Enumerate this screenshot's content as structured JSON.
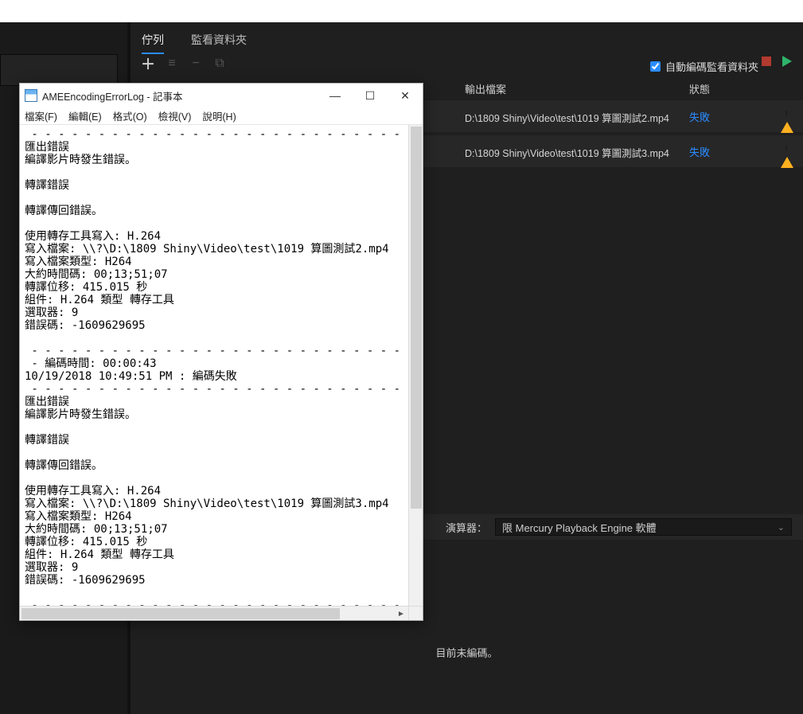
{
  "app": {
    "tabs": {
      "queue": "佇列",
      "watch": "監看資料夾"
    },
    "auto_watch": "自動編碼監看資料夾",
    "columns": {
      "output": "輸出檔案",
      "status": "狀態"
    },
    "rows": [
      {
        "output": "D:\\1809 Shiny\\Video\\test\\1019 算圖測試2.mp4",
        "status": "失敗"
      },
      {
        "output": "D:\\1809 Shiny\\Video\\test\\1019 算圖測試3.mp4",
        "status": "失敗"
      }
    ],
    "renderer_label": "演算器：",
    "renderer_value": "限 Mercury Playback Engine 軟體",
    "status_footer": "目前未編碼。"
  },
  "notepad": {
    "title": "AMEEncodingErrorLog - 記事本",
    "menu": {
      "file": "檔案(F)",
      "edit": "編輯(E)",
      "format": "格式(O)",
      "view": "檢視(V)",
      "help": "說明(H)"
    },
    "body": " - - - - - - - - - - - - - - - - - - - - - - - - - - - - - - - - - - - - - - - - -\n匯出錯誤\n編譯影片時發生錯誤。\n\n轉譯錯誤\n\n轉譯傳回錯誤。\n\n使用轉存工具寫入: H.264\n寫入檔案: \\\\?\\D:\\1809 Shiny\\Video\\test\\1019 算圖測試2.mp4\n寫入檔案類型: H264\n大約時間碼: 00;13;51;07\n轉譯位移: 415.015 秒\n組件: H.264 類型 轉存工具\n選取器: 9\n錯誤碼: -1609629695\n\n - - - - - - - - - - - - - - - - - - - - - - - - - - - - - - - - - - - - - - - - -\n - 編碼時間: 00:00:43\n10/19/2018 10:49:51 PM : 編碼失敗\n - - - - - - - - - - - - - - - - - - - - - - - - - - - - - - - - - - - - - - - - -\n匯出錯誤\n編譯影片時發生錯誤。\n\n轉譯錯誤\n\n轉譯傳回錯誤。\n\n使用轉存工具寫入: H.264\n寫入檔案: \\\\?\\D:\\1809 Shiny\\Video\\test\\1019 算圖測試3.mp4\n寫入檔案類型: H264\n大約時間碼: 00;13;51;07\n轉譯位移: 415.015 秒\n組件: H.264 類型 轉存工具\n選取器: 9\n錯誤碼: -1609629695\n\n - - - - - - - - - - - - - - - - - - - - - - - - - - - - - - - - - - - - - - - - -"
  }
}
